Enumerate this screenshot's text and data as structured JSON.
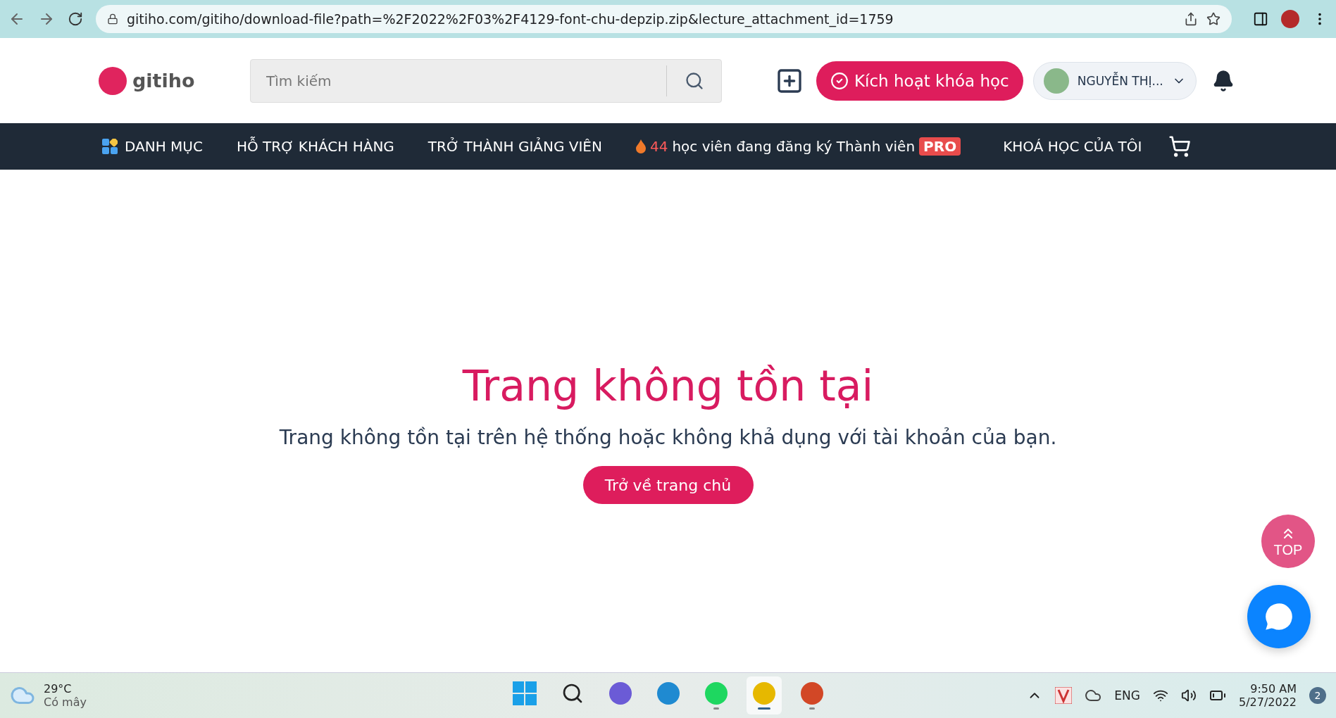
{
  "browser": {
    "url": "gitiho.com/gitiho/download-file?path=%2F2022%2F03%2F4129-font-chu-depzip.zip&lecture_attachment_id=1759"
  },
  "header": {
    "logo": "gitiho",
    "search": {
      "placeholder": "Tìm kiếm"
    },
    "activate_button": "Kích hoạt khóa học",
    "user": "NGUYỄN THỊ..."
  },
  "nav": {
    "items": [
      {
        "kind": "menu",
        "label": "DANH MỤC"
      },
      {
        "kind": "link",
        "label": "HỖ TRỢ KHÁCH HÀNG"
      },
      {
        "kind": "link",
        "label": "TRỞ THÀNH GIẢNG VIÊN"
      }
    ],
    "promo": {
      "count": "44",
      "text": "học viên đang đăng ký Thành viên",
      "badge": "PRO"
    },
    "my_courses": "KHOÁ HỌC CỦA TÔI"
  },
  "main": {
    "title": "Trang không tồn tại",
    "message": "Trang không tồn tại trên hệ thống hoặc không khả dụng với tài khoản của bạn.",
    "button": "Trở về trang chủ"
  },
  "top_button": "TOP",
  "taskbar": {
    "weather": {
      "temp": "29°C",
      "condition": "Có mây"
    },
    "apps": [
      {
        "kind": "start",
        "running": false,
        "selected": false
      },
      {
        "kind": "search",
        "running": false,
        "selected": false
      },
      {
        "kind": "chat",
        "running": false,
        "selected": false
      },
      {
        "kind": "edge",
        "running": false,
        "selected": false
      },
      {
        "kind": "spotify",
        "running": true,
        "selected": false
      },
      {
        "kind": "chrome",
        "running": true,
        "selected": true
      },
      {
        "kind": "powerpoint",
        "running": true,
        "selected": false
      }
    ],
    "language": "ENG",
    "time": "9:50 AM",
    "date": "5/27/2022",
    "notifications": "2"
  }
}
